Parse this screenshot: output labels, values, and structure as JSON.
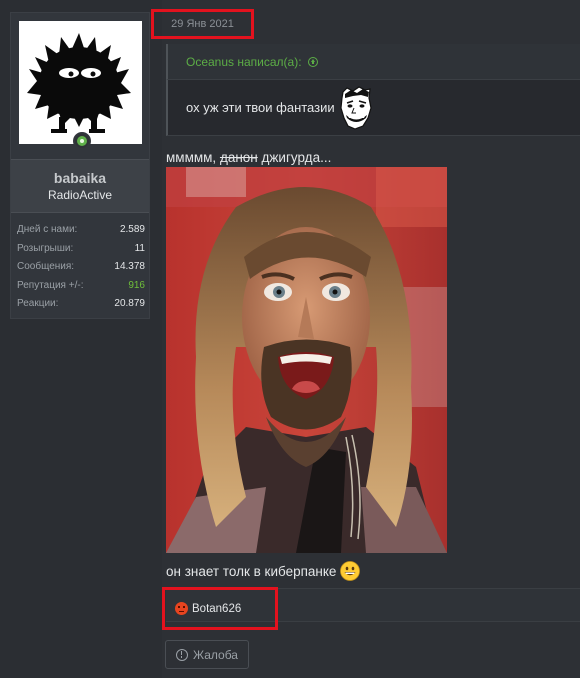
{
  "author": {
    "username": "babaika",
    "title": "RadioActive",
    "avatar_icon": "fluffy-monster-icon",
    "online_status": "online",
    "stats": [
      {
        "label": "Дней с нами:",
        "value": "2.589",
        "highlight": false
      },
      {
        "label": "Розыгрыши:",
        "value": "11",
        "highlight": false
      },
      {
        "label": "Сообщения:",
        "value": "14.378",
        "highlight": false
      },
      {
        "label": "Репутация +/-:",
        "value": "916",
        "highlight": true
      },
      {
        "label": "Реакции:",
        "value": "20.879",
        "highlight": false
      }
    ]
  },
  "post": {
    "date": "29 Янв 2021",
    "quote": {
      "author_line": "Oceanus написал(а):",
      "text": "ох уж эти твои фантазии",
      "smiley_icon": "troll-face-icon"
    },
    "message_prefix": "ммммм,",
    "message_strike": "данон",
    "message_suffix": "джигурда...",
    "image_icon": "long-haired-man-photo",
    "message_line2": "он знает толк в киберпанке",
    "message_line2_icon": "grinning-face-icon",
    "reactions": {
      "icon": "angry-face-icon",
      "user": "Botan626"
    },
    "report_label": "Жалоба"
  },
  "colors": {
    "background": "#2d3035",
    "accent_green": "#5cad46",
    "highlight_red": "#e3121e"
  }
}
